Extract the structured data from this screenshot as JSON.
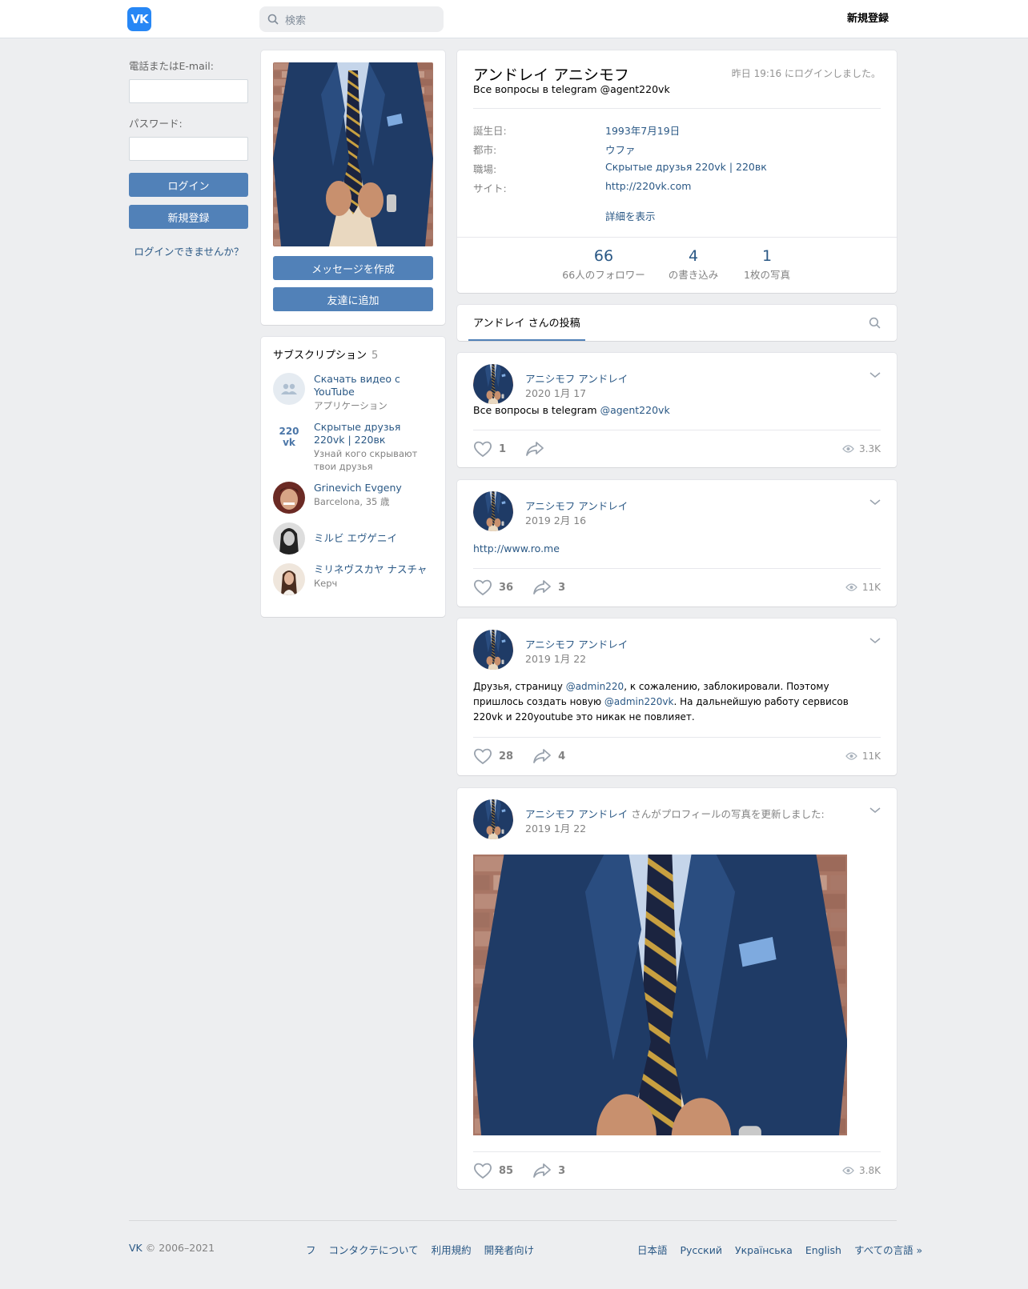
{
  "header": {
    "logo": "VK",
    "search_placeholder": "検索",
    "register": "新規登録"
  },
  "login": {
    "phone_label": "電話またはE-mail:",
    "password_label": "パスワード:",
    "login_button": "ログイン",
    "register_button": "新規登録",
    "forgot": "ログインできませんか？"
  },
  "profile": {
    "message_button": "メッセージを作成",
    "add_friend_button": "友達に追加",
    "name": "アンドレイ アニシモフ",
    "status": "Все вопросы в telegram @agent220vk",
    "last_seen": "昨日 19:16 にログインしました。",
    "info": [
      {
        "key": "誕生日:",
        "value": "1993年7月19日"
      },
      {
        "key": "都市:",
        "value": "ウファ"
      },
      {
        "key": "職場:",
        "value": "Скрытые друзья 220vk | 220вк"
      },
      {
        "key": "サイト:",
        "value": "http://220vk.com"
      }
    ],
    "show_more": "詳細を表示",
    "counters": [
      {
        "num": "66",
        "label": "66人のフォロワー"
      },
      {
        "num": "4",
        "label": "の書き込み"
      },
      {
        "num": "1",
        "label": "1枚の写真"
      }
    ]
  },
  "subscriptions": {
    "title": "サブスクリプション",
    "count": "5",
    "items": [
      {
        "name": "Скачать видео с YouTube",
        "desc": "アプリケーション"
      },
      {
        "name": "Скрытые друзья 220vk | 220вк",
        "desc": "Узнай кого скрывают твои друзья",
        "logo": "220vk"
      },
      {
        "name": "Grinevich Evgeny",
        "desc": "Barcelona, 35 歳"
      },
      {
        "name": "ミルビ エヴゲニイ",
        "desc": ""
      },
      {
        "name": "ミリネヴスカヤ ナスチャ",
        "desc": "Керч"
      }
    ]
  },
  "wall": {
    "tab": "アンドレイ さんの投稿"
  },
  "posts": [
    {
      "author": "アニシモフ アンドレイ",
      "date": "2020 1月 17",
      "text_pre": "Все вопросы в telegram ",
      "link1": "@agent220vk",
      "likes": "1",
      "shares": "",
      "views": "3.3K"
    },
    {
      "author": "アニシモフ アンドレイ",
      "date": "2019 2月 16",
      "link1": "http://www.ro.me",
      "likes": "36",
      "shares": "3",
      "views": "11K"
    },
    {
      "author": "アニシモフ アンドレイ",
      "date": "2019 1月 22",
      "t1": "Друзья, страницу ",
      "link1": "@admin220",
      "t2": ", к сожалению, заблокировали. Поэтому пришлось создать новую ",
      "link2": "@admin220vk",
      "t3": ". На дальнейшую работу сервисов 220vk и 220youtube это никак не повлияет.",
      "likes": "28",
      "shares": "4",
      "views": "11K"
    },
    {
      "author": "アニシモフ アンドレイ",
      "action": " さんがプロフィールの写真を更新しました:",
      "date": "2019 1月 22",
      "likes": "85",
      "shares": "3",
      "views": "3.8K"
    }
  ],
  "footer": {
    "copy_brand": "VK",
    "copy": " © 2006–2021",
    "links": [
      "フ",
      "コンタクテについて",
      "利用規約",
      "開発者向け"
    ],
    "langs": [
      "日本語",
      "Русский",
      "Українська",
      "English",
      "すべての言語 »"
    ]
  },
  "colors": {
    "accent": "#5181b8",
    "link": "#2a5885",
    "logo": "#2787f5",
    "bg": "#edeef0"
  }
}
